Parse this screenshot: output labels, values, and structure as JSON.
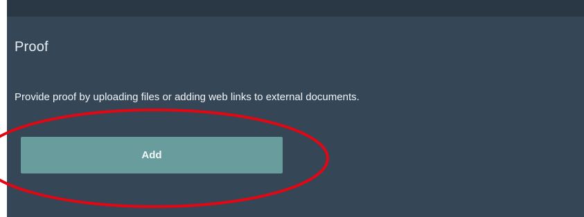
{
  "window": {
    "header_bar_color": "#2a3744"
  },
  "proof_panel": {
    "title": "Proof",
    "description": "Provide proof by uploading files or adding web links to external documents.",
    "add_button_label": "Add",
    "panel_color": "#354657",
    "button_color": "#689c9d"
  },
  "annotation": {
    "type": "ellipse-highlight",
    "stroke_color": "#e30613",
    "target": "add-button"
  }
}
